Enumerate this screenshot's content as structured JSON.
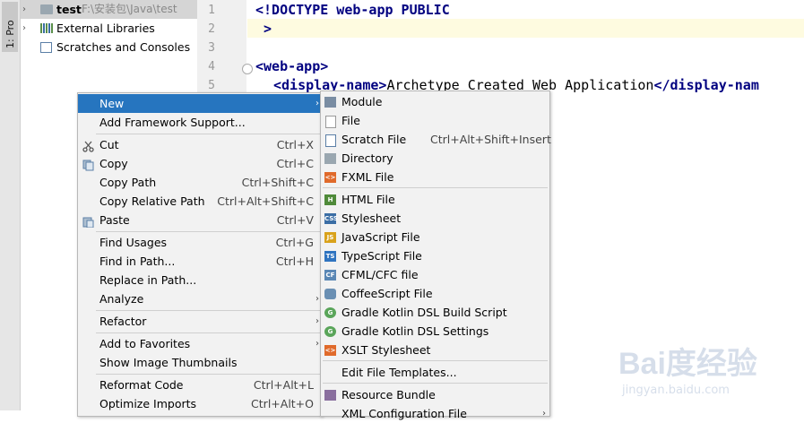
{
  "toolstrip": {
    "project_tab": "1: Pro"
  },
  "project": {
    "items": [
      {
        "name": "test",
        "path": "F:\\安装包\\Java\\test"
      },
      {
        "name": "External Libraries"
      },
      {
        "name": "Scratches and Consoles"
      }
    ]
  },
  "editor": {
    "line_numbers": [
      "1",
      "2",
      "3",
      "4",
      "5"
    ],
    "lines": {
      "l1": "<!DOCTYPE web-app PUBLIC",
      "l2": " >",
      "l4_tag": "<web-app>",
      "l5_open": "<display-name>",
      "l5_text": "Archetype Created Web Application",
      "l5_close": "</display-nam"
    }
  },
  "context_menu": {
    "items": [
      {
        "label": "New",
        "submenu": true
      },
      {
        "label": "Add Framework Support..."
      },
      {
        "label": "Cut",
        "shortcut": "Ctrl+X",
        "icon": "scissors-icon"
      },
      {
        "label": "Copy",
        "shortcut": "Ctrl+C",
        "icon": "copy-icon"
      },
      {
        "label": "Copy Path",
        "shortcut": "Ctrl+Shift+C"
      },
      {
        "label": "Copy Relative Path",
        "shortcut": "Ctrl+Alt+Shift+C"
      },
      {
        "label": "Paste",
        "shortcut": "Ctrl+V",
        "icon": "paste-icon"
      },
      {
        "label": "Find Usages",
        "shortcut": "Ctrl+G"
      },
      {
        "label": "Find in Path...",
        "shortcut": "Ctrl+H"
      },
      {
        "label": "Replace in Path..."
      },
      {
        "label": "Analyze",
        "submenu": true
      },
      {
        "label": "Refactor",
        "submenu": true
      },
      {
        "label": "Add to Favorites",
        "submenu": true
      },
      {
        "label": "Show Image Thumbnails"
      },
      {
        "label": "Reformat Code",
        "shortcut": "Ctrl+Alt+L"
      },
      {
        "label": "Optimize Imports",
        "shortcut": "Ctrl+Alt+O"
      }
    ]
  },
  "new_submenu": {
    "items": [
      {
        "label": "Module",
        "icon": "module-icon"
      },
      {
        "label": "File",
        "icon": "file-icon"
      },
      {
        "label": "Scratch File",
        "shortcut": "Ctrl+Alt+Shift+Insert",
        "icon": "scratch-file-icon"
      },
      {
        "label": "Directory",
        "icon": "folder-icon"
      },
      {
        "label": "FXML File",
        "icon": "fxml-icon",
        "badge": "<>"
      },
      {
        "label": "HTML File",
        "icon": "html-icon",
        "badge": "H"
      },
      {
        "label": "Stylesheet",
        "icon": "css-icon",
        "badge": "CSS"
      },
      {
        "label": "JavaScript File",
        "icon": "js-icon",
        "badge": "JS"
      },
      {
        "label": "TypeScript File",
        "icon": "ts-icon",
        "badge": "TS"
      },
      {
        "label": "CFML/CFC file",
        "icon": "cf-icon",
        "badge": "CF"
      },
      {
        "label": "CoffeeScript File",
        "icon": "coffeescript-icon"
      },
      {
        "label": "Gradle Kotlin DSL Build Script",
        "icon": "gradle-icon",
        "badge": "G"
      },
      {
        "label": "Gradle Kotlin DSL Settings",
        "icon": "gradle-icon",
        "badge": "G"
      },
      {
        "label": "XSLT Stylesheet",
        "icon": "xslt-icon",
        "badge": "<>"
      },
      {
        "label": "Edit File Templates..."
      },
      {
        "label": "Resource Bundle",
        "icon": "resource-bundle-icon"
      },
      {
        "label": "XML Configuration File",
        "submenu": true
      }
    ]
  },
  "watermark": {
    "logo": "Bai度经验",
    "url": "jingyan.baidu.com"
  },
  "colors": {
    "highlight": "#2675bf",
    "menu_bg": "#f2f2f2",
    "tag": "#000080"
  }
}
